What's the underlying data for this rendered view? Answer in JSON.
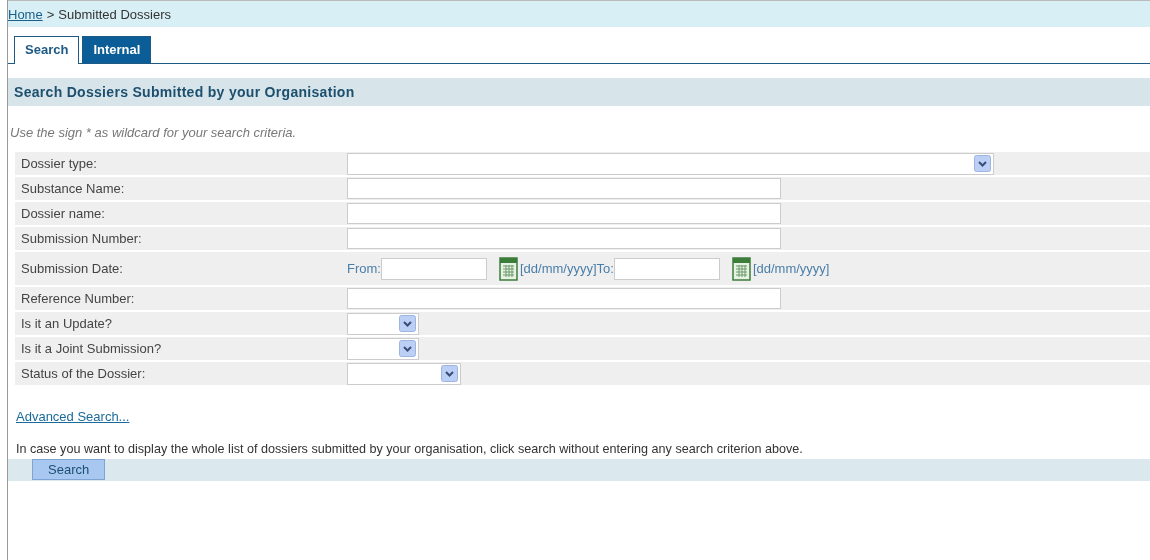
{
  "breadcrumb": {
    "links": [
      "Home"
    ],
    "separator": ">",
    "current": "Submitted Dossiers"
  },
  "tabs": [
    {
      "label": "Search",
      "selected": true
    },
    {
      "label": "Internal",
      "selected": false
    }
  ],
  "section_title": "Search Dossiers Submitted by your Organisation",
  "hint": "Use the sign * as wildcard for your search criteria.",
  "fields": [
    {
      "label": "Dossier type:",
      "kind": "wideselect"
    },
    {
      "label": "Substance Name:",
      "kind": "text"
    },
    {
      "label": "Dossier name:",
      "kind": "text"
    },
    {
      "label": "Submission Number:",
      "kind": "text"
    },
    {
      "label": "Submission Date:",
      "kind": "date",
      "from_label": "From:",
      "from_format": "[dd/mm/yyyy]",
      "to_label": "To:",
      "to_format": "[dd/mm/yyyy]"
    },
    {
      "label": "Reference Number:",
      "kind": "text"
    },
    {
      "label": "Is it an Update?",
      "kind": "select"
    },
    {
      "label": "Is it a Joint Submission?",
      "kind": "select"
    },
    {
      "label": "Status of the Dossier:",
      "kind": "midselect"
    }
  ],
  "advanced_link": "Advanced Search...",
  "note": "In case you want to display the whole list of dossiers submitted by your organisation, click search without entering any search criterion above.",
  "search_button": "Search"
}
